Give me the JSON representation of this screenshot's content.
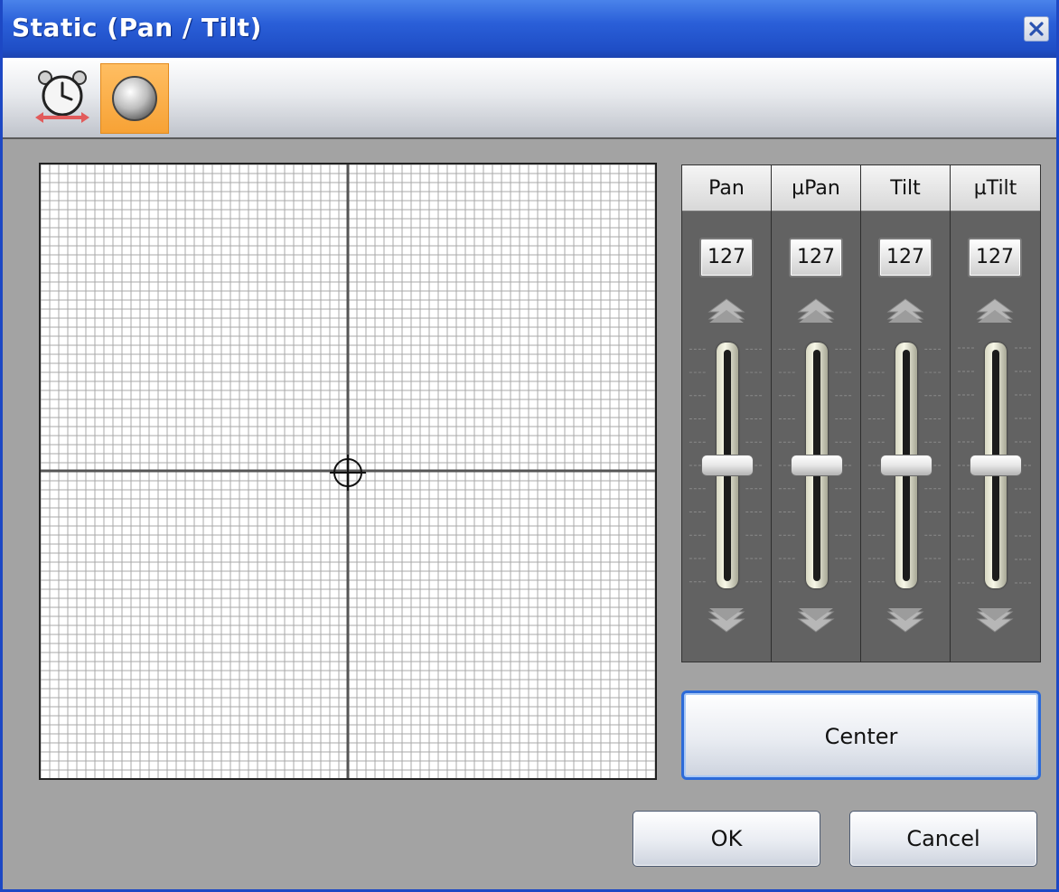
{
  "window": {
    "title": "Static (Pan / Tilt)"
  },
  "toolbar": {
    "buttons": [
      {
        "icon": "alarm-clock-icon",
        "active": false
      },
      {
        "icon": "sphere-icon",
        "active": true
      }
    ]
  },
  "grid": {
    "crosshair_icon": "crosshair-icon"
  },
  "faders": [
    {
      "label": "Pan",
      "value": "127",
      "level": 0.5
    },
    {
      "label": "µPan",
      "value": "127",
      "level": 0.5
    },
    {
      "label": "Tilt",
      "value": "127",
      "level": 0.5
    },
    {
      "label": "µTilt",
      "value": "127",
      "level": 0.5
    }
  ],
  "buttons": {
    "center": "Center",
    "ok": "OK",
    "cancel": "Cancel"
  },
  "colors": {
    "title_bar": "#2a5fd8",
    "active_tool": "#f7a235",
    "panel_bg": "#a3a3a3"
  }
}
